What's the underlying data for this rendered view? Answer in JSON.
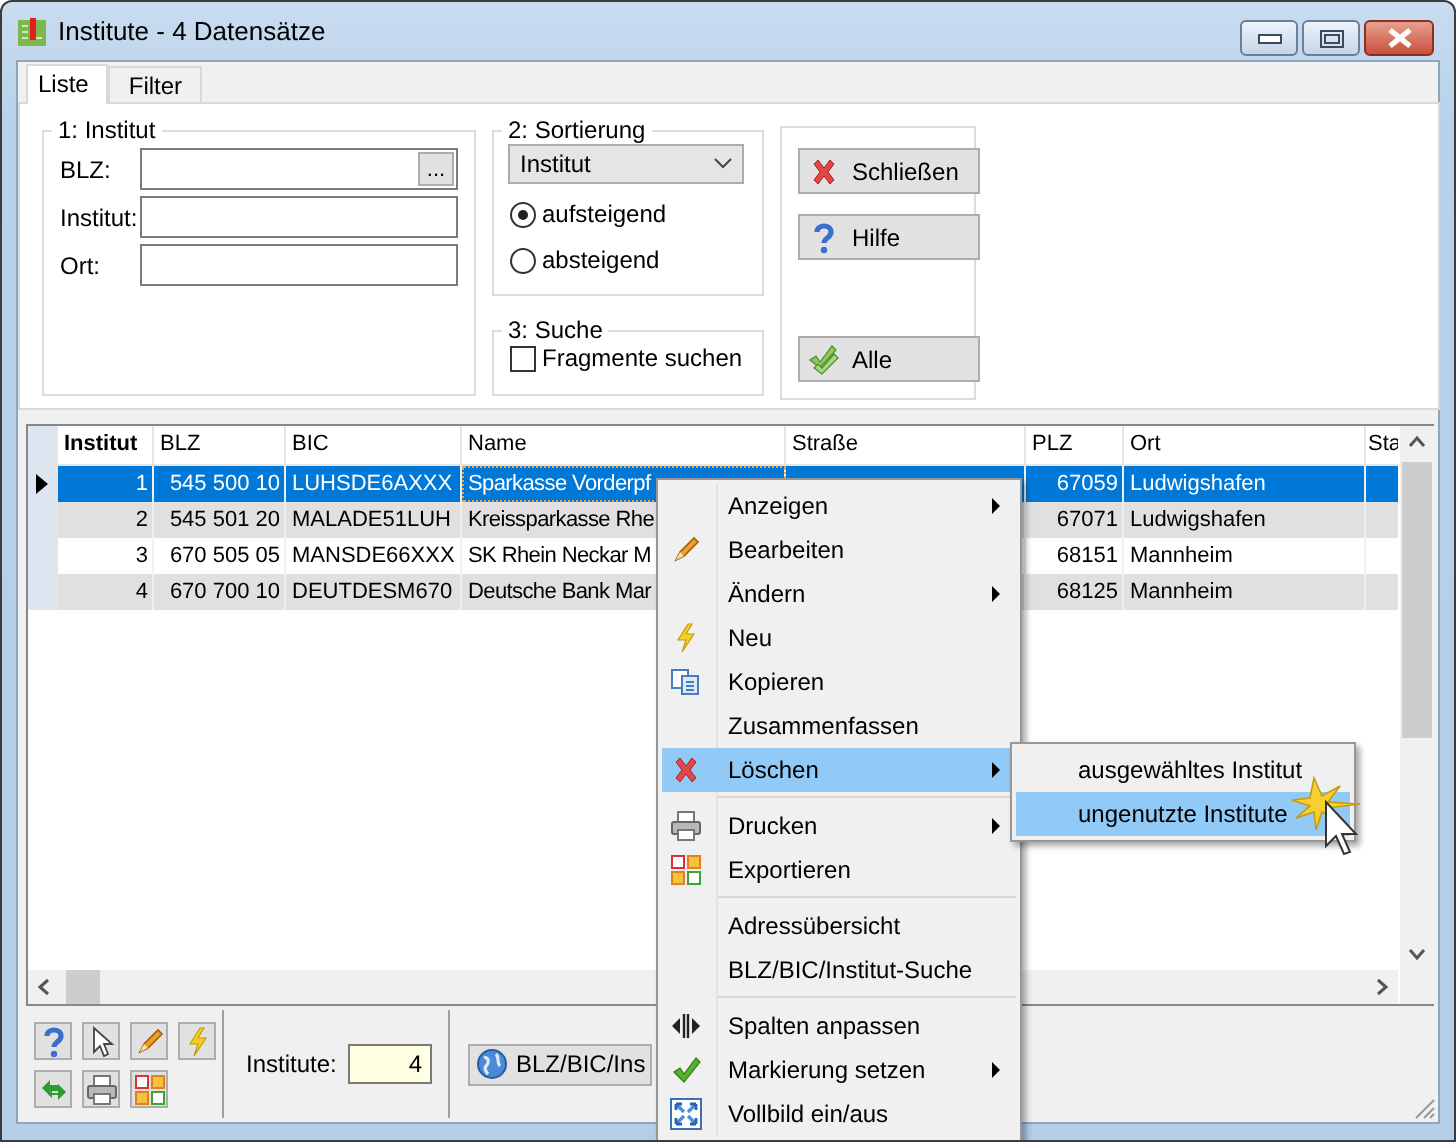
{
  "window": {
    "title": "Institute - 4 Datensätze"
  },
  "tabs": [
    {
      "label": "Liste",
      "selected": true
    },
    {
      "label": "Filter",
      "selected": false
    }
  ],
  "institut_group": {
    "title": "1: Institut",
    "fields": [
      {
        "label": "BLZ:",
        "button": "..."
      },
      {
        "label": "Institut:"
      },
      {
        "label": "Ort:"
      }
    ]
  },
  "sort_group": {
    "title": "2: Sortierung",
    "dropdown": "Institut",
    "options": [
      {
        "label": "aufsteigend",
        "selected": true
      },
      {
        "label": "absteigend",
        "selected": false
      }
    ]
  },
  "search_group": {
    "title": "3: Suche",
    "checkbox": {
      "label": "Fragmente suchen",
      "checked": false
    }
  },
  "buttons": [
    "Schließen",
    "Hilfe",
    "Alle"
  ],
  "table": {
    "columns": [
      {
        "label": "Institut",
        "sorted": true
      },
      {
        "label": "BLZ",
        "sorted": false
      },
      {
        "label": "BIC",
        "sorted": false
      },
      {
        "label": "Name",
        "sorted": false
      },
      {
        "label": "Straße",
        "sorted": false
      },
      {
        "label": "PLZ",
        "sorted": false
      },
      {
        "label": "Ort",
        "sorted": false
      },
      {
        "label": "Sta",
        "sorted": false
      }
    ],
    "rows": [
      {
        "selected": true,
        "institut": "1",
        "blz": "545 500 10",
        "bic": "LUHSDE6AXXX",
        "name": "Sparkasse Vorderpf",
        "plz": "67059",
        "ort": "Ludwigshafen"
      },
      {
        "selected": false,
        "institut": "2",
        "blz": "545 501 20",
        "bic": "MALADE51LUH",
        "name": "Kreissparkasse Rhe",
        "plz": "67071",
        "ort": "Ludwigshafen"
      },
      {
        "selected": false,
        "institut": "3",
        "blz": "670 505 05",
        "bic": "MANSDE66XXX",
        "name": "SK Rhein Neckar M",
        "plz": "68151",
        "ort": "Mannheim"
      },
      {
        "selected": false,
        "institut": "4",
        "blz": "670 700 10",
        "bic": "DEUTDESM670",
        "name": "Deutsche Bank Mar",
        "plz": "68125",
        "ort": "Mannheim"
      }
    ]
  },
  "status_bar": {
    "count_label": "Institute:",
    "count": "4",
    "search_button": "BLZ/BIC/Ins"
  },
  "context_menu": {
    "items": [
      {
        "kind": "item",
        "label": "Anzeigen",
        "submenu": true,
        "selected": false
      },
      {
        "kind": "item",
        "label": "Bearbeiten",
        "submenu": false,
        "selected": false
      },
      {
        "kind": "item",
        "label": "Ändern",
        "submenu": true,
        "selected": false
      },
      {
        "kind": "item",
        "label": "Neu",
        "submenu": false,
        "selected": false
      },
      {
        "kind": "item",
        "label": "Kopieren",
        "submenu": false,
        "selected": false
      },
      {
        "kind": "item",
        "label": "Zusammenfassen",
        "submenu": false,
        "selected": false
      },
      {
        "kind": "item",
        "label": "Löschen",
        "submenu": true,
        "selected": true
      },
      {
        "kind": "separator"
      },
      {
        "kind": "item",
        "label": "Drucken",
        "submenu": true,
        "selected": false
      },
      {
        "kind": "item",
        "label": "Exportieren",
        "submenu": false,
        "selected": false
      },
      {
        "kind": "separator"
      },
      {
        "kind": "item",
        "label": "Adressübersicht",
        "submenu": false,
        "selected": false
      },
      {
        "kind": "item",
        "label": "BLZ/BIC/Institut-Suche",
        "submenu": false,
        "selected": false
      },
      {
        "kind": "separator"
      },
      {
        "kind": "item",
        "label": "Spalten anpassen",
        "submenu": false,
        "selected": false
      },
      {
        "kind": "item",
        "label": "Markierung setzen",
        "submenu": true,
        "selected": false
      },
      {
        "kind": "item",
        "label": "Vollbild ein/aus",
        "submenu": false,
        "selected": false
      }
    ]
  },
  "submenu": {
    "items": [
      {
        "label": "ausgewähltes Institut",
        "selected": false
      },
      {
        "label": "ungenutzte Institute",
        "selected": true
      }
    ]
  }
}
